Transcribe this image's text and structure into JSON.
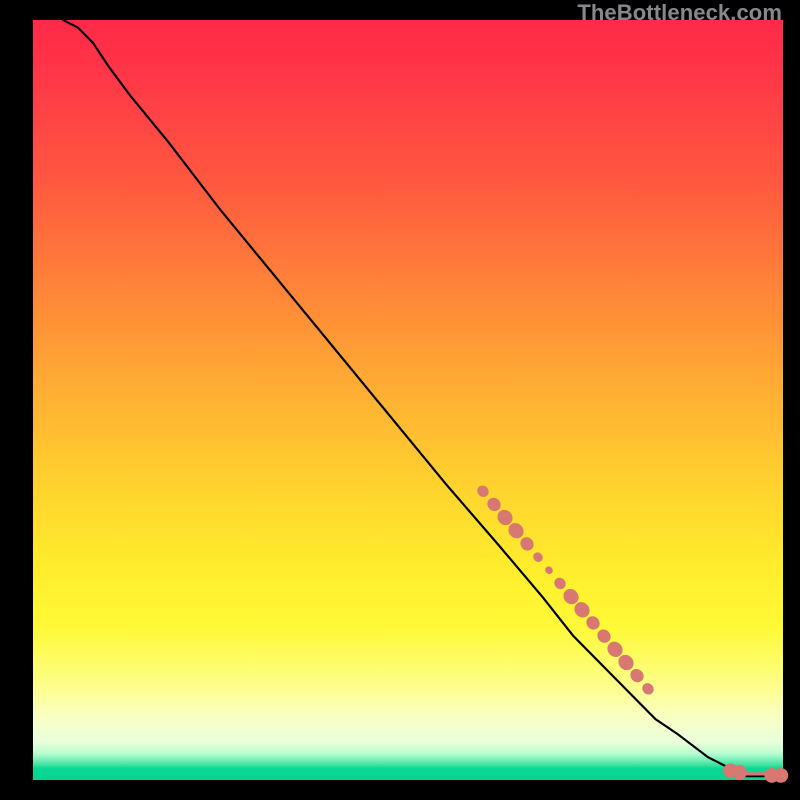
{
  "watermark": "TheBottleneck.com",
  "chart_data": {
    "type": "line",
    "title": "",
    "xlabel": "",
    "ylabel": "",
    "xlim": [
      0,
      100
    ],
    "ylim": [
      0,
      100
    ],
    "grid": false,
    "legend": false,
    "series": [
      {
        "name": "bottleneck-curve",
        "stroke": "#000000",
        "x": [
          4,
          6,
          8,
          10,
          13,
          18,
          25,
          35,
          45,
          55,
          62,
          68,
          72,
          76,
          80,
          83,
          86,
          90,
          93,
          95,
          100
        ],
        "y": [
          100,
          99,
          97,
          94,
          90,
          84,
          75,
          63,
          51,
          39,
          31,
          24,
          19,
          15,
          11,
          8,
          6,
          3,
          1.5,
          0.5,
          0.5
        ]
      }
    ],
    "markers": [
      {
        "name": "cluster-upper",
        "shape": "blob",
        "color": "#d77872",
        "x_range": [
          60,
          82
        ],
        "y_range": [
          12,
          38
        ]
      },
      {
        "name": "end-dot-1",
        "shape": "circle",
        "color": "#d77872",
        "x": 93,
        "y": 1.2,
        "r": 1.1
      },
      {
        "name": "end-dot-2",
        "shape": "circle",
        "color": "#d77872",
        "x": 94.2,
        "y": 1.0,
        "r": 1.1
      },
      {
        "name": "end-dot-3",
        "shape": "circle",
        "color": "#d77872",
        "x": 98.5,
        "y": 0.6,
        "r": 1.1
      },
      {
        "name": "end-dot-4",
        "shape": "circle",
        "color": "#d77872",
        "x": 99.7,
        "y": 0.6,
        "r": 1.1
      }
    ],
    "background_gradient": {
      "0": "#ff2a49",
      "50": "#ffb233",
      "80": "#fff937",
      "95": "#eaffda",
      "100": "#07d492"
    }
  }
}
